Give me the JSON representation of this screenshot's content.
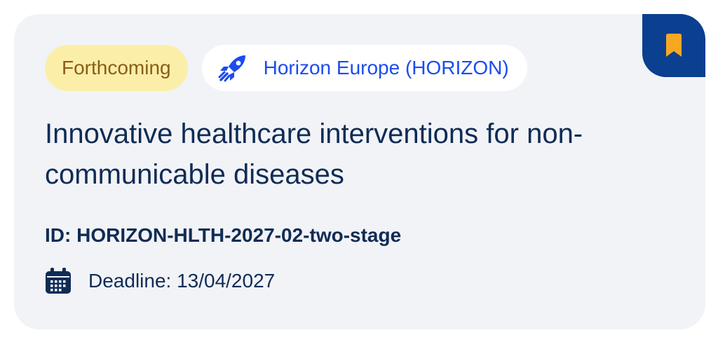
{
  "card": {
    "status_label": "Forthcoming",
    "program": {
      "icon": "rocket-icon",
      "label": "Horizon Europe (HORIZON)"
    },
    "title": "Innovative healthcare interventions for non-communicable diseases",
    "id_text": "ID: HORIZON-HLTH-2027-02-two-stage",
    "deadline_text": "Deadline: 13/04/2027",
    "deadline_icon": "calendar-icon",
    "bookmark_icon": "bookmark-icon"
  },
  "colors": {
    "card_background": "#f2f3f7",
    "status_background": "#fbeea8",
    "status_text": "#8a5d1a",
    "program_text": "#1a4cf0",
    "title_text": "#0f2c55",
    "bookmark_background": "#0b3f8f",
    "bookmark_accent": "#f7a823"
  }
}
